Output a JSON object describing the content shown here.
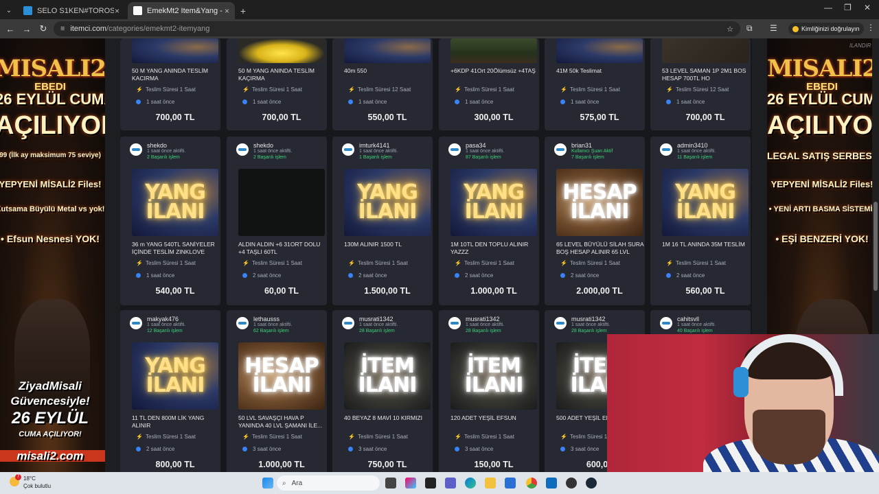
{
  "browser": {
    "tabs": [
      {
        "label": "SELO S1KEN#TOROS (TR) - Leag",
        "active": false,
        "favicon_color": "#2b8fd8"
      },
      {
        "label": "EmekMt2 Item&Yang - Metin2",
        "active": true,
        "favicon_color": "#ffffff"
      }
    ],
    "url_host": "itemci.com",
    "url_path": "/categories/emekmt2-itemyang",
    "signin_label": "Kimliğinizi doğrulayın"
  },
  "ad_left": {
    "logo": "MISALI2",
    "logo_sub": "EBEDI",
    "lines": [
      "26 EYLÜL CUMA",
      "AÇILIYOR!",
      "99 (İlk ay maksimum 75 seviye)",
      "YEPYENİ MİSALİ2 Files!",
      "Kutsama Büyülü Metal vs yok!",
      "• Efsun Nesnesi YOK!"
    ],
    "footer": [
      "ZiyadMisali",
      "Güvencesiyle!",
      "26 EYLÜL",
      "CUMA AÇILIYOR!",
      "misali2.com"
    ]
  },
  "ad_right": {
    "brand_tag": "ILANDIR",
    "logo": "MISALI2",
    "logo_sub": "EBEDI",
    "lines": [
      "26 EYLÜL CUMA",
      "AÇILIYOR!",
      "LEGAL SATIŞ SERBEST!",
      "YEPYENİ MİSALİ2 Files!",
      "• YENİ ARTI BASMA SİSTEMİ!",
      "• EŞİ BENZERİ YOK!"
    ]
  },
  "listing_common": {
    "delivery_prefix": "Teslim Süresi"
  },
  "rows": [
    {
      "cards": [
        {
          "image": "yang",
          "overlay": "",
          "title": "50 M YANG ANINDA TESLİM KACIRMA",
          "delivery": "Teslim Süresi 1 Saat",
          "time": "1 saat önce",
          "price": "700,00 TL"
        },
        {
          "image": "coins",
          "overlay": "",
          "title": "50 M YANG ANINDA TESLİM KAÇIRMA",
          "delivery": "Teslim Süresi 1 Saat",
          "time": "1 saat önce",
          "price": "700,00 TL"
        },
        {
          "image": "yang",
          "overlay": "",
          "title": "40m 550",
          "delivery": "Teslim Süresi 12 Saat",
          "time": "1 saat önce",
          "price": "550,00 TL"
        },
        {
          "image": "game",
          "overlay": "",
          "title": "+6KDP 41Ort 20Ölümsüz +4TAŞ",
          "delivery": "Teslim Süresi 1 Saat",
          "time": "1 saat önce",
          "price": "300,00 TL"
        },
        {
          "image": "yang",
          "overlay": "",
          "title": "41M 50k Teslimat",
          "delivery": "Teslim Süresi 1 Saat",
          "time": "1 saat önce",
          "price": "575,00 TL"
        },
        {
          "image": "inventory",
          "overlay": "",
          "title": "53 LEVEL SAMAN 1P 2M1 BOS HESAP 700TL HO",
          "delivery": "Teslim Süresi 12 Saat",
          "time": "1 saat önce",
          "price": "700,00 TL"
        }
      ]
    },
    {
      "cards": [
        {
          "seller": "shekdo",
          "last": "1 saat önce aktifti.",
          "online": false,
          "success": "2 Başarılı işlem",
          "image": "yang",
          "overlay": "YANG İLANI",
          "title": "36 m YANG 540TL SANİYELER İÇİNDE TESLİM ZINKLOVE",
          "delivery": "Teslim Süresi 1 Saat",
          "time": "1 saat önce",
          "price": "540,00 TL"
        },
        {
          "seller": "shekdo",
          "last": "1 saat önce aktifti.",
          "online": false,
          "success": "2 Başarılı işlem",
          "image": "screen",
          "overlay": "",
          "title": "ALDIN ALDIN +6 31ORT DOLU +4 TAŞLI 60TL",
          "delivery": "Teslim Süresi 1 Saat",
          "time": "2 saat önce",
          "price": "60,00 TL"
        },
        {
          "seller": "imturk4141",
          "last": "1 saat önce aktifti.",
          "online": false,
          "success": "1 Başarılı işlem",
          "image": "yang",
          "overlay": "YANG İLANI",
          "title": "130M ALINIR 1500 TL",
          "delivery": "Teslim Süresi 1 Saat",
          "time": "2 saat önce",
          "price": "1.500,00 TL"
        },
        {
          "seller": "pasa34",
          "last": "1 saat önce aktifti.",
          "online": false,
          "success": "87 Başarılı işlem",
          "image": "yang",
          "overlay": "YANG İLANI",
          "title": "1M 10TL DEN TOPLU ALINIR YAZZZ",
          "delivery": "Teslim Süresi 1 Saat",
          "time": "2 saat önce",
          "price": "1.000,00 TL"
        },
        {
          "seller": "brian31",
          "last": "Kullanıcı Şuan Aktif",
          "online": true,
          "success": "7 Başarılı işlem",
          "image": "hesap",
          "overlay": "HESAP İLANI",
          "title": "65 LEVEL BÜYÜLÜ SİLAH SURA BOŞ HESAP ALINIR 65 LVL ALT...",
          "delivery": "Teslim Süresi 1 Saat",
          "time": "2 saat önce",
          "price": "2.000,00 TL"
        },
        {
          "seller": "admin3410",
          "last": "1 saat önce aktifti.",
          "online": false,
          "success": "11 Başarılı işlem",
          "image": "yang",
          "overlay": "YANG İLANI",
          "title": "1M 16 TL ANINDA 35M TESLİM",
          "delivery": "Teslim Süresi 1 Saat",
          "time": "2 saat önce",
          "price": "560,00 TL"
        }
      ]
    },
    {
      "cards": [
        {
          "seller": "makyak476",
          "last": "1 saat önce aktifti.",
          "online": false,
          "success": "12 Başarılı işlem",
          "image": "yang",
          "overlay": "YANG İLANI",
          "title": "11 TL DEN 800M LİK YANG ALINIR",
          "delivery": "Teslim Süresi 1 Saat",
          "time": "2 saat önce",
          "price": "800,00 TL"
        },
        {
          "seller": "lethausss",
          "last": "1 saat önce aktifti.",
          "online": false,
          "success": "62 Başarılı işlem",
          "image": "hesap",
          "overlay": "HESAP İLANI",
          "title": "50 LVL SAVAŞÇI HAVA P YANINDA 40 LVL ŞAMANI İLE...",
          "delivery": "Teslim Süresi 1 Saat",
          "time": "3 saat önce",
          "price": "1.000,00 TL"
        },
        {
          "seller": "musrati1342",
          "last": "1 saat önce aktifti.",
          "online": false,
          "success": "28 Başarılı işlem",
          "image": "item",
          "overlay": "İTEM İLANI",
          "title": "40 BEYAZ 8 MAVİ 10 KIRMIZI",
          "delivery": "Teslim Süresi 1 Saat",
          "time": "3 saat önce",
          "price": "750,00 TL"
        },
        {
          "seller": "musrati1342",
          "last": "1 saat önce aktifti.",
          "online": false,
          "success": "28 Başarılı işlem",
          "image": "item",
          "overlay": "İTEM İLANI",
          "title": "120 ADET YEŞİL EFSUN",
          "delivery": "Teslim Süresi 1 Saat",
          "time": "3 saat önce",
          "price": "150,00 TL"
        },
        {
          "seller": "musrati1342",
          "last": "1 saat önce aktifti.",
          "online": false,
          "success": "28 Başarılı işlem",
          "image": "item",
          "overlay": "İTEM İLANI",
          "title": "500 ADET YEŞİL EF",
          "delivery": "Teslim Süresi 1 Saat",
          "time": "3 saat önce",
          "price": "600,00"
        },
        {
          "seller": "cahitsvll",
          "last": "1 saat önce aktifti.",
          "online": false,
          "success": "40 Başarılı işlem",
          "image": "fantasy",
          "overlay": "",
          "title": "",
          "delivery": "",
          "time": "",
          "price": ""
        }
      ]
    }
  ],
  "taskbar": {
    "temperature": "18°C",
    "weather": "Çok bulutlu",
    "notification_count": "7",
    "search_placeholder": "Ara"
  }
}
